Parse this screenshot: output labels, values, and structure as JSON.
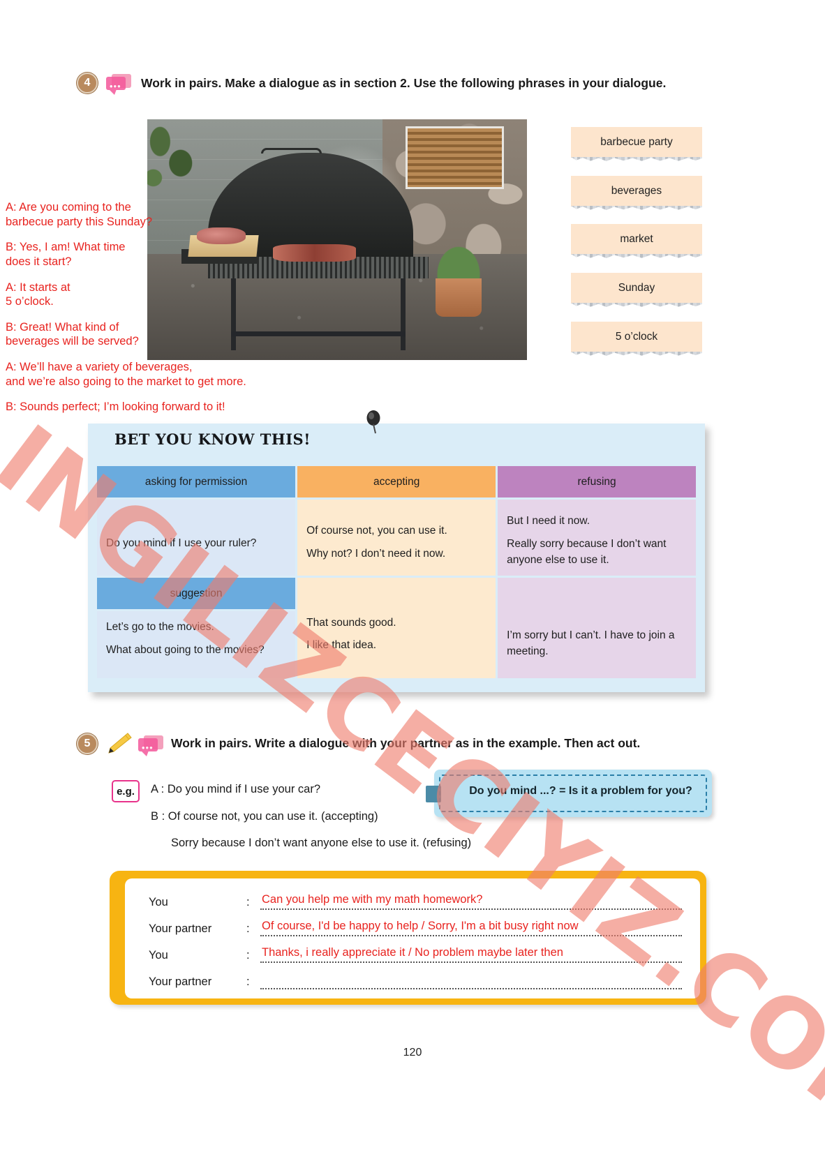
{
  "exercise4": {
    "number": "4",
    "icon": "speech-bubble-icon",
    "instruction": "Work in pairs. Make a dialogue as in section 2. Use the following phrases in your dialogue."
  },
  "photo": {
    "alt": "barbecue-grill-photo"
  },
  "word_cards": [
    {
      "label": "barbecue party"
    },
    {
      "label": "beverages"
    },
    {
      "label": "market"
    },
    {
      "label": "Sunday"
    },
    {
      "label": "5 o’clock"
    }
  ],
  "handwritten_dialogue": [
    "A: Are you coming to the\nbarbecue party this Sunday?",
    "B: Yes, I am! What time\ndoes it start?",
    "A: It starts at\n5 o’clock.",
    "B: Great! What kind of\nbeverages will be served?",
    "A: We’ll have a variety of beverages,\nand we’re also going to the market to get more.",
    "B: Sounds perfect; I’m looking forward to it!"
  ],
  "bet_panel": {
    "title": "BET YOU KNOW THIS!",
    "pin": "pushpin-icon",
    "headers": {
      "permission": "asking for permission",
      "accepting": "accepting",
      "refusing": "refusing",
      "suggestion": "suggestion"
    },
    "row1": {
      "permission": "Do you mind if I use your ruler?",
      "accepting": [
        "Of course not, you can use it.",
        "Why not? I don’t need it now."
      ],
      "refusing": [
        "But I need it now.",
        "Really sorry because I don’t want anyone else to use it."
      ]
    },
    "row2": {
      "suggestion": [
        "Let’s go to the movies.",
        "What about going to the movies?"
      ],
      "accepting": [
        "That sounds good.",
        "I like that idea."
      ],
      "refusing": [
        "I’m sorry but I can’t. I have to join a meeting."
      ]
    },
    "colors": {
      "panel_bg": "#daedf8",
      "header_blue": "#6aabde",
      "header_orange": "#f9b161",
      "header_purple": "#bd83bf",
      "cell_blue": "#dbe7f6",
      "cell_orange": "#fdeacf",
      "cell_purple": "#e6d5e9"
    }
  },
  "exercise5": {
    "number": "5",
    "icons": [
      "pencil-icon",
      "speech-bubble-icon"
    ],
    "instruction": "Work in pairs. Write a dialogue with your partner as in the example. Then act out.",
    "eg_badge": "e.g.",
    "example_lines": [
      "A :  Do you mind if I use your car?",
      "B :  Of course not, you can use it. (accepting)",
      "Sorry because I don’t want anyone else to use it. (refusing)"
    ],
    "tip": {
      "text": "Do you mind ...? = Is it a problem for you?",
      "bg": "#b7e2f3",
      "dash_color": "#2b7fa8"
    }
  },
  "answer_box": {
    "accent": "#f7b412",
    "rows": [
      {
        "label": "You",
        "colon": ":",
        "answer": "Can you help me with my math homework?"
      },
      {
        "label": "Your partner",
        "colon": ":",
        "answer": "Of course, I'd be happy to help / Sorry, I'm a bit busy right now"
      },
      {
        "label": "You",
        "colon": ":",
        "answer": "Thanks, i really appreciate it  / No problem maybe later then"
      },
      {
        "label": "Your partner",
        "colon": ":",
        "answer": ""
      }
    ]
  },
  "watermark": {
    "text": "INGILIZCECIYIZ.COM",
    "color": "#ef7d6e"
  },
  "page_number": "120"
}
